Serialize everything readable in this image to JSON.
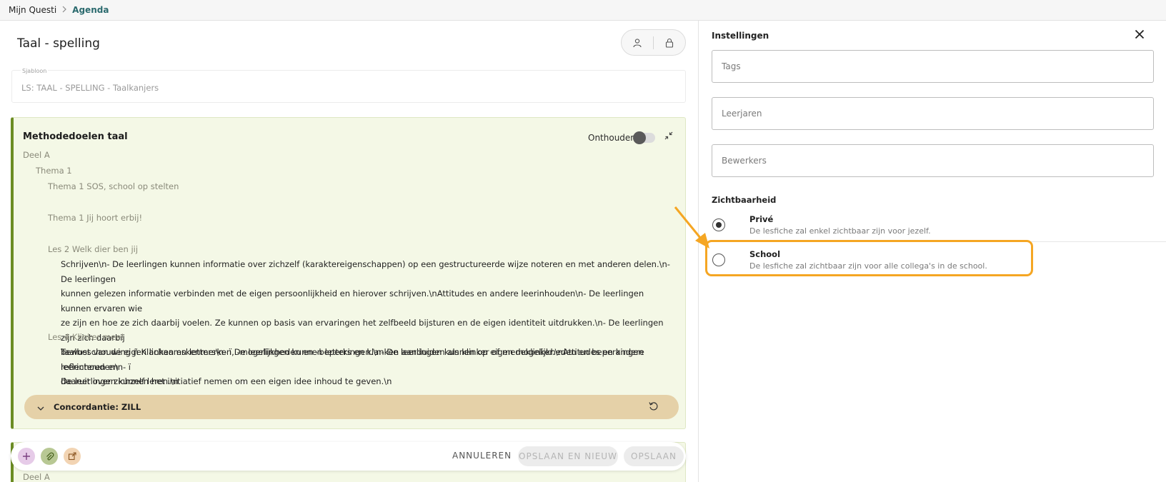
{
  "breadcrumb": {
    "root": "Mijn Questi",
    "current": "Agenda"
  },
  "page": {
    "title": "Taal - spelling",
    "template_label": "Sjabloon",
    "template_value": "LS: TAAL - SPELLING - Taalkanjers"
  },
  "card": {
    "title": "Methodedoelen taal",
    "remember_label": "Onthouden",
    "deel": "Deel A",
    "thema": "Thema 1",
    "items": [
      "Thema 1 SOS, school op stelten",
      "Thema 1 Jij hoort erbij!",
      "Les 2 Welk dier ben jij"
    ],
    "les2_lines": [
      "Schrijven\\n- De leerlingen kunnen informatie over zichzelf (karaktereigenschappen) op een gestructureerde wijze noteren en met anderen delen.\\n- De leerlingen",
      "kunnen gelezen informatie verbinden met de eigen persoonlijkheid en hierover schrijven.\\nAttitudes en andere leerinhouden\\n- De leerlingen kunnen ervaren wie",
      "ze zijn en hoe ze zich daarbij voelen. Ze kunnen op basis van ervaringen het zelfbeeld bijsturen en de eigen identiteit uitdrukken.\\n- De leerlingen zijn zich daarbij",
      "bewust van de eigen lichaamskenmerken, -mogelijkheden en -beperkingen.\\n- De leerlingen kunnen op eigen mogelijkheden en beperkingen reflecteren en",
      "daaruit over zichzelf leren.\\n"
    ],
    "les4_title": "Les 4 Klinker mee!",
    "les4_lines": [
      "Taalbeschouwing ñ Klanken en letters\\n- ï De leerlingen kunnen letters en klanken aanduiden als klinker of medeklinker.\\nAttitudes en andere leerinhouden\\n- ï",
      "De leerlingen kunnen het initiatief nemen om een eigen idee inhoud te geven.\\n"
    ],
    "concordance": "Concordantie: ZILL"
  },
  "card2": {
    "deel": "Deel A"
  },
  "actions": {
    "cancel": "ANNULEREN",
    "save_new": "OPSLAAN EN NIEUW",
    "save": "OPSLAAN"
  },
  "settings": {
    "title": "Instellingen",
    "tags_placeholder": "Tags",
    "years_placeholder": "Leerjaren",
    "editors_placeholder": "Bewerkers",
    "visibility_title": "Zichtbaarheid",
    "options": [
      {
        "label": "Privé",
        "desc": "De lesfiche zal enkel zichtbaar zijn voor jezelf.",
        "checked": true
      },
      {
        "label": "School",
        "desc": "De lesfiche zal zichtbaar zijn voor alle collega's in de school.",
        "checked": false
      }
    ]
  },
  "colors": {
    "accent_teal": "#2b6a6e",
    "card_bg": "#f4f8e6",
    "card_border": "#6b8c23",
    "concordance_bg": "#e5d1a8",
    "highlight": "#f5a623"
  },
  "icons": [
    "chevron-right-icon",
    "user-icon",
    "lock-icon",
    "collapse-icon",
    "chevron-down-icon",
    "reset-icon",
    "plus-icon",
    "paperclip-icon",
    "share-icon",
    "close-icon"
  ]
}
